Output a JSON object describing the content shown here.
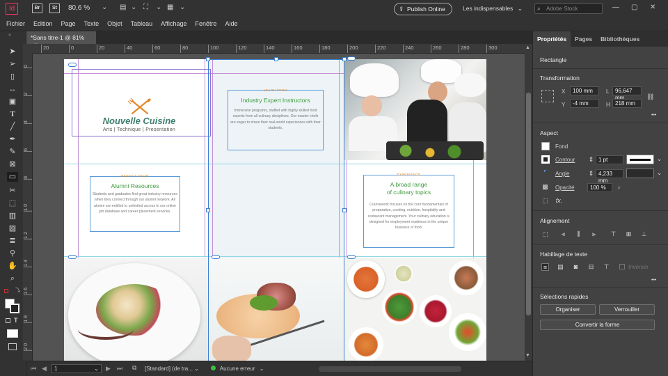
{
  "app": {
    "logo": "Id",
    "bridge": "Br",
    "stock": "St",
    "zoom": "80,6 %",
    "publish_label": "Publish Online",
    "workspace": "Les indispensables",
    "search_placeholder": "Adobe Stock"
  },
  "menu": [
    "Fichier",
    "Edition",
    "Page",
    "Texte",
    "Objet",
    "Tableau",
    "Affichage",
    "Fenêtre",
    "Aide"
  ],
  "doc_tab": {
    "title": "*Sans titre-1 @ 81%",
    "close": "×"
  },
  "ruler": {
    "h_ticks": [
      "20",
      "0",
      "20",
      "40",
      "60",
      "80",
      "100",
      "120",
      "140",
      "160",
      "180",
      "200",
      "220",
      "240",
      "260",
      "280",
      "300"
    ],
    "v_ticks": [
      "0",
      "2",
      "4",
      "6",
      "8",
      "1 0",
      "1 2",
      "1 4",
      "1 6",
      "1 8",
      "2 0"
    ]
  },
  "document": {
    "brand": {
      "name": "Nouvelle Cuisine",
      "tagline": "Arts | Technique | Presentation"
    },
    "panel1": {
      "caption": "LEARN FROM",
      "title": "Industry Expert Instructors",
      "body": "Immersive programs, staffed with highly skilled food experts from all culinary disciplines. Our master chefs are eager to share their real-world experiences with their students."
    },
    "panel2": {
      "caption": "BENEFIT FROM",
      "title": "Alumni Resources",
      "body": "Students and graduates find great industry resources when they connect through our alumni network. All alumni are entitled to unlimited access to our online job database and career placement services."
    },
    "panel3": {
      "caption": "EXPERIENCE",
      "title_line1": "A broad range",
      "title_line2": "of culinary topics",
      "body": "Coursework focuses on the core fundamentals of preparation, cooking, nutrition, hospitality and restaurant management. Your culinary education is designed for employment readiness in the unique business of food."
    }
  },
  "status": {
    "page": "1",
    "style": "[Standard] (de tra...",
    "preflight": "Aucune erreur"
  },
  "panel": {
    "tabs": [
      "Propriétés",
      "Pages",
      "Bibliothèques"
    ],
    "object_type": "Rectangle",
    "transform": {
      "heading": "Transformation",
      "x_label": "X",
      "x": "100 mm",
      "y_label": "Y",
      "y": "-4 mm",
      "l_label": "L",
      "l": "96,647 mm",
      "h_label": "H",
      "h": "218 mm"
    },
    "aspect": {
      "heading": "Aspect",
      "fill": "Fond",
      "stroke": "Contour",
      "stroke_value": "1 pt",
      "corner": "Angle",
      "corner_value": "4,233 mm",
      "opacity": "Opacité",
      "opacity_value": "100 %",
      "fx": "fx."
    },
    "alignment": {
      "heading": "Alignement"
    },
    "wrap": {
      "heading": "Habillage de texte",
      "invert": "Inverser"
    },
    "quick": {
      "heading": "Sélections rapides",
      "group": "Organiser",
      "lock": "Verrouiller",
      "convert": "Convertir la forme"
    },
    "more": "•••"
  }
}
